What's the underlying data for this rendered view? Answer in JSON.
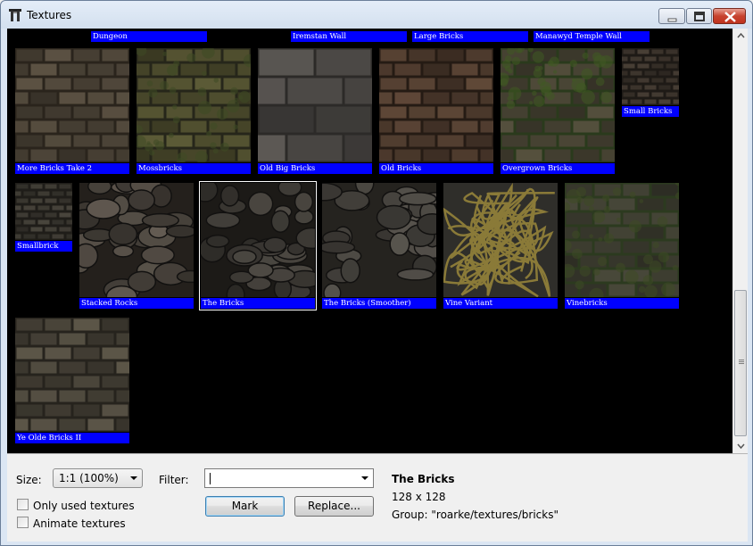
{
  "window": {
    "title": "Textures",
    "controls": {
      "minimize": "minimize",
      "maximize": "maximize",
      "close": "close"
    }
  },
  "header_strip": [
    "Dungeon",
    "Iremstan Wall",
    "Large Bricks",
    "Manawyd Temple Wall"
  ],
  "textures": [
    {
      "name": "More Bricks Take 2",
      "pattern": "bricks",
      "colors": [
        "#4a4236",
        "#2a241c"
      ]
    },
    {
      "name": "Mossbricks",
      "pattern": "moss",
      "colors": [
        "#4b4a2c",
        "#26261a"
      ]
    },
    {
      "name": "Old Big Bricks",
      "pattern": "bigbricks",
      "colors": [
        "#4a4744",
        "#2c2a28"
      ]
    },
    {
      "name": "Old Bricks",
      "pattern": "bricks",
      "colors": [
        "#4d3a2d",
        "#251b14"
      ]
    },
    {
      "name": "Overgrown Bricks",
      "pattern": "overgrown",
      "colors": [
        "#444031",
        "#2a3a1c"
      ]
    },
    {
      "name": "Small Bricks",
      "pattern": "bricks",
      "colors": [
        "#3c342c",
        "#1e1a16"
      ]
    },
    {
      "name": "Smallbrick",
      "pattern": "bricks",
      "colors": [
        "#3a3730",
        "#1f1d19"
      ]
    },
    {
      "name": "Stacked Rocks",
      "pattern": "rocks",
      "colors": [
        "#4c463f",
        "#24201c"
      ]
    },
    {
      "name": "The Bricks",
      "pattern": "rocks",
      "colors": [
        "#3d3a35",
        "#1c1a17"
      ],
      "selected": true
    },
    {
      "name": "The Bricks (Smoother)",
      "pattern": "rocks",
      "colors": [
        "#45423d",
        "#25231f"
      ]
    },
    {
      "name": "Vine Variant",
      "pattern": "vines",
      "colors": [
        "#2f2e2a",
        "#8a7a38"
      ]
    },
    {
      "name": "Vinebricks",
      "pattern": "moss",
      "colors": [
        "#3a3a2e",
        "#2c3a1f"
      ]
    },
    {
      "name": "Ye Olde Bricks II",
      "pattern": "bricks",
      "colors": [
        "#4a453a",
        "#26231d"
      ]
    }
  ],
  "controls": {
    "size_label": "Size:",
    "size_value": "1:1 (100%)",
    "filter_label": "Filter:",
    "filter_value": "",
    "mark_button": "Mark",
    "replace_button": "Replace...",
    "only_used_label": "Only used textures",
    "animate_label": "Animate textures"
  },
  "selection_info": {
    "name": "The Bricks",
    "dimensions": "128 x 128",
    "group": "Group: \"roarke/textures/bricks\""
  },
  "theme": {
    "label_bg": "#0000ff",
    "viewer_bg": "#000000"
  }
}
